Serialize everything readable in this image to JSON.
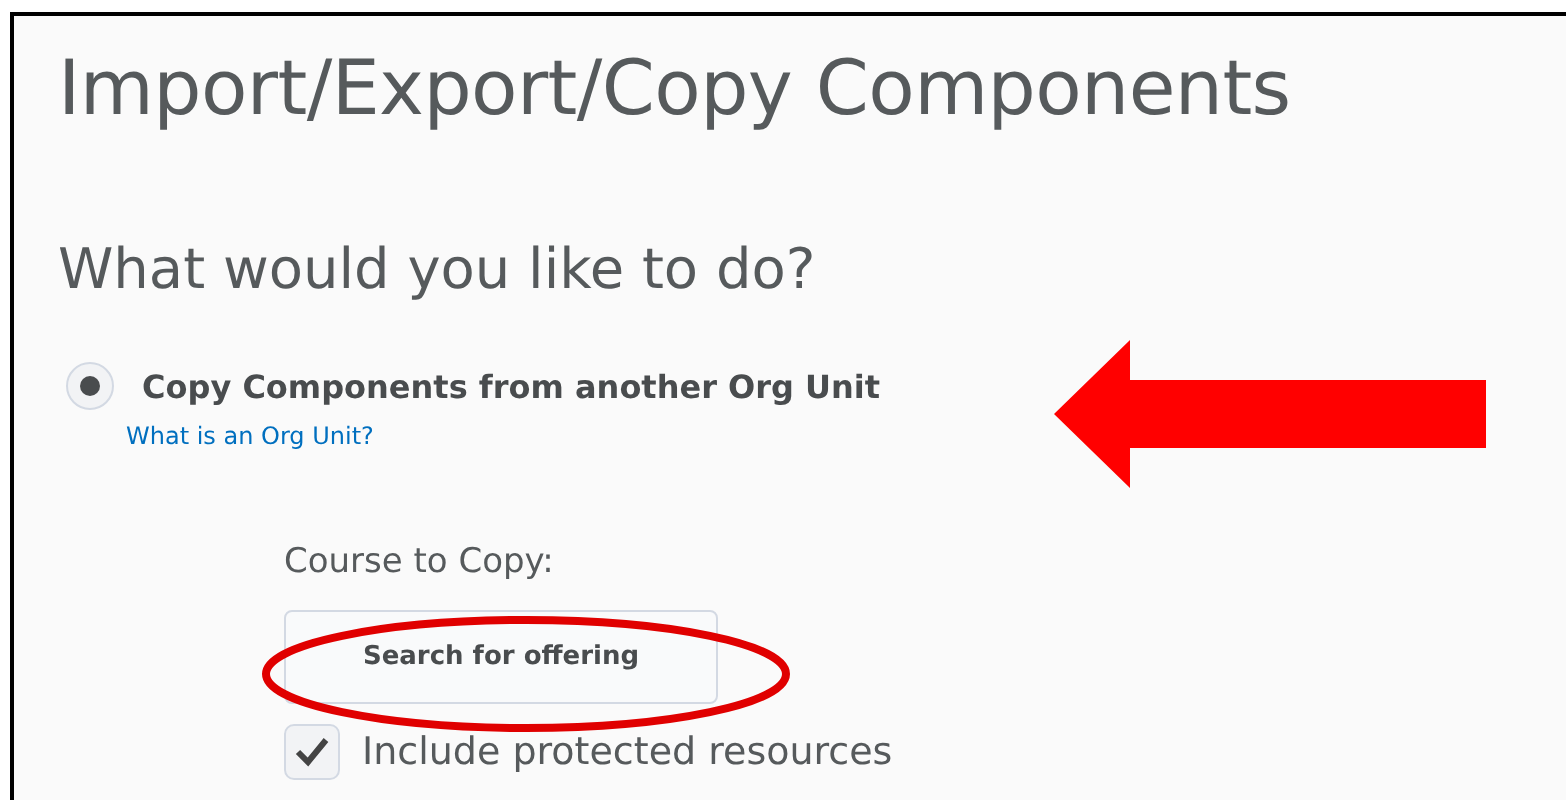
{
  "page_title": "Import/Export/Copy Components",
  "question": "What would you like to do?",
  "option": {
    "label": "Copy Components from another Org Unit",
    "selected": true,
    "help_link": "What is an Org Unit?"
  },
  "course_to_copy": {
    "label": "Course to Copy:",
    "button": "Search for offering"
  },
  "include_protected": {
    "label": "Include protected resources",
    "checked": true
  }
}
